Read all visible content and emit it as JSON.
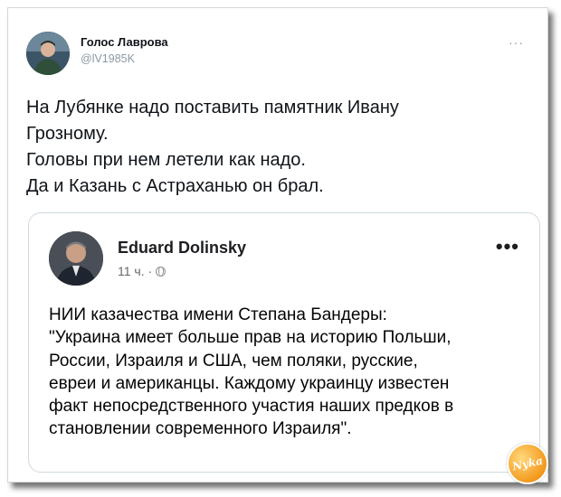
{
  "tweet": {
    "display_name": "Голос Лаврова",
    "handle": "@lV1985K",
    "more": "···",
    "text_lines": [
      "На Лубянке надо поставить памятник Ивану",
      "Грозному.",
      "Головы при нем летели как надо.",
      "Да и Казань с Астраханью он брал."
    ]
  },
  "quoted_post": {
    "author": "Eduard Dolinsky",
    "time": "11 ч. ·",
    "more": "•••",
    "text_lines": [
      "НИИ казачества имени Степана Бандеры:",
      "\"Украина имеет больше прав на историю Польши,",
      "России, Израиля и США, чем поляки, русские,",
      "евреи и американцы. Каждому украинцу известен",
      "факт непосредственного участия наших предков в",
      "становлении современного Израиля\"."
    ]
  },
  "watermark": {
    "text": "Nyka"
  },
  "colors": {
    "handle": "#8a98a4",
    "border": "#cfd9de",
    "watermark": "#f39a1e"
  }
}
